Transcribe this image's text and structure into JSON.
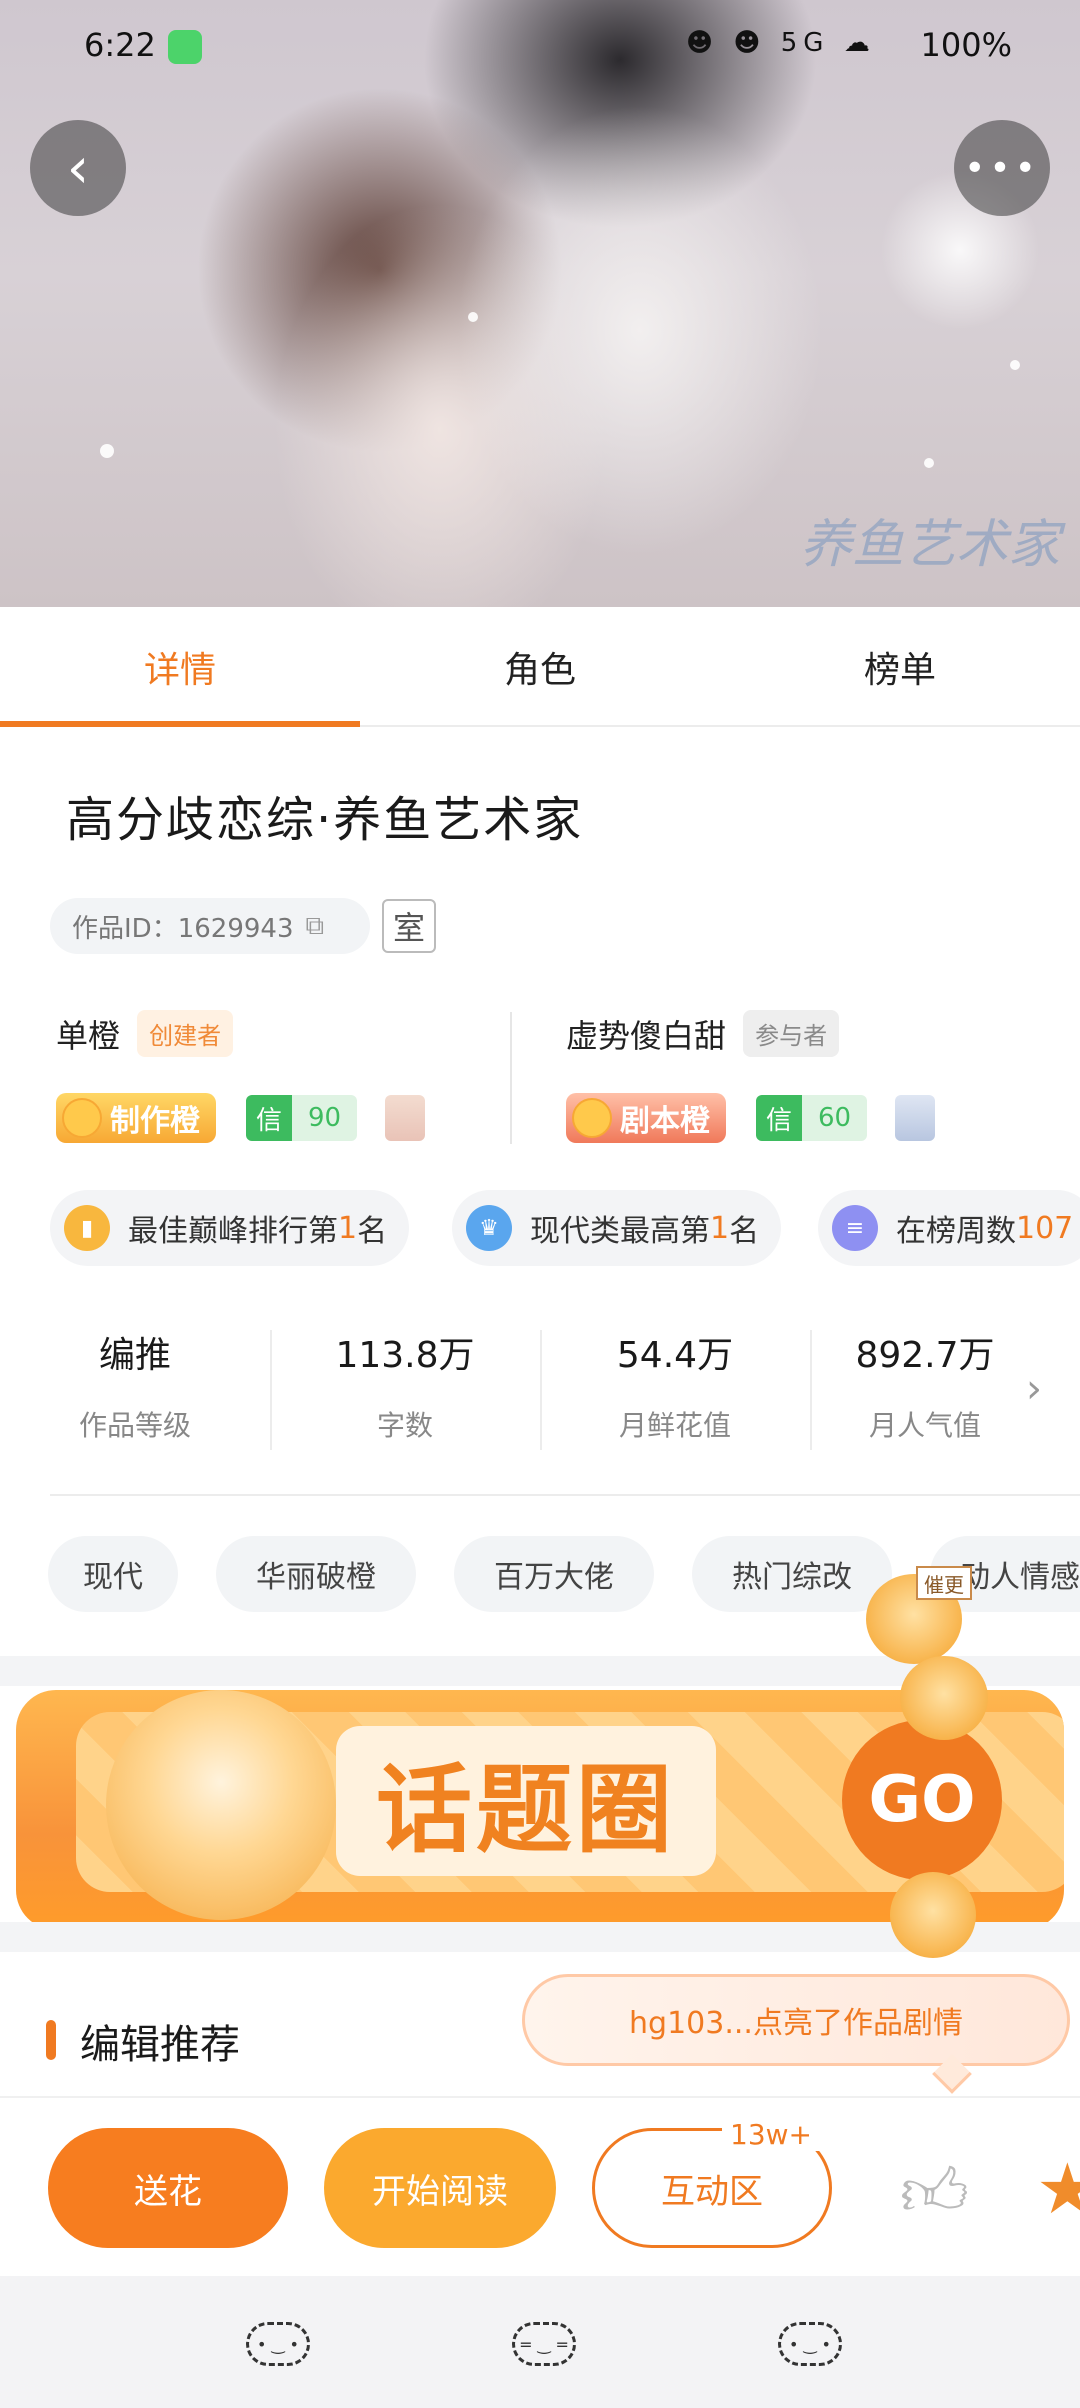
{
  "status_bar": {
    "time": "6:22",
    "icons": "☻ ☻ 5G ☁",
    "battery": "100%"
  },
  "hero": {
    "watermark": "养鱼艺术家"
  },
  "tabs": [
    {
      "label": "详情"
    },
    {
      "label": "角色"
    },
    {
      "label": "榜单"
    }
  ],
  "work": {
    "title": "高分歧恋综·养鱼艺术家",
    "id_label": "作品ID：1629943",
    "room_label": "室"
  },
  "authors": [
    {
      "name": "单橙",
      "role": "创建者",
      "medal": "制作橙",
      "credit_label": "信",
      "credit_value": "90"
    },
    {
      "name": "虚势傻白甜",
      "role": "参与者",
      "medal": "剧本橙",
      "credit_label": "信",
      "credit_value": "60"
    }
  ],
  "rank_chips": [
    {
      "prefix": "最佳巅峰排行第",
      "num": "1",
      "suffix": "名"
    },
    {
      "prefix": "现代类最高第",
      "num": "1",
      "suffix": "名"
    },
    {
      "prefix": "在榜周数",
      "num": "107",
      "suffix": ""
    }
  ],
  "stats": [
    {
      "value": "编推",
      "label": "作品等级"
    },
    {
      "value": "113.8万",
      "label": "字数"
    },
    {
      "value": "54.4万",
      "label": "月鲜花值"
    },
    {
      "value": "892.7万",
      "label": "月人气值"
    }
  ],
  "tags": [
    "现代",
    "华丽破橙",
    "百万大佬",
    "热门综改",
    "动人情感"
  ],
  "banner": {
    "title": "话题圈",
    "go": "GO"
  },
  "mascot_text": "催更",
  "section": {
    "title": "编辑推荐"
  },
  "toast": {
    "text": "hg103...点亮了作品剧情"
  },
  "actions": {
    "flower": "送花",
    "read": "开始阅读",
    "interact": "互动区",
    "interact_count": "13w+"
  },
  "nav": {
    "icons": [
      "back-icon",
      "home-icon",
      "recent-icon"
    ]
  },
  "colors": {
    "accent": "#f07a21",
    "accent_light": "#fba92e",
    "credit_green": "#3dbb5f"
  }
}
